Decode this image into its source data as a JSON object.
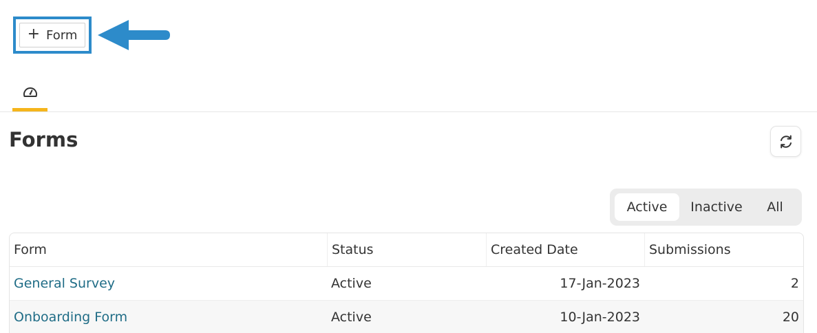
{
  "toolbar": {
    "add_button": {
      "icon": "+",
      "label": "Form"
    },
    "callout_color": "#2d8bca"
  },
  "tabs": [
    {
      "name": "dashboard",
      "icon": "gauge-icon",
      "active": true,
      "accent": "#f5b51c"
    }
  ],
  "page": {
    "title": "Forms",
    "refresh_icon": "refresh-icon"
  },
  "status_filter": {
    "options": [
      "Active",
      "Inactive",
      "All"
    ],
    "selected": "Active"
  },
  "table": {
    "columns": [
      "Form",
      "Status",
      "Created Date",
      "Submissions"
    ],
    "rows": [
      {
        "form": "General Survey",
        "status": "Active",
        "created": "17-Jan-2023",
        "submissions": "2"
      },
      {
        "form": "Onboarding Form",
        "status": "Active",
        "created": "10-Jan-2023",
        "submissions": "20"
      }
    ]
  },
  "colors": {
    "link": "#1f6c86",
    "tab_accent": "#f5b51c",
    "highlight": "#2d8bca"
  }
}
